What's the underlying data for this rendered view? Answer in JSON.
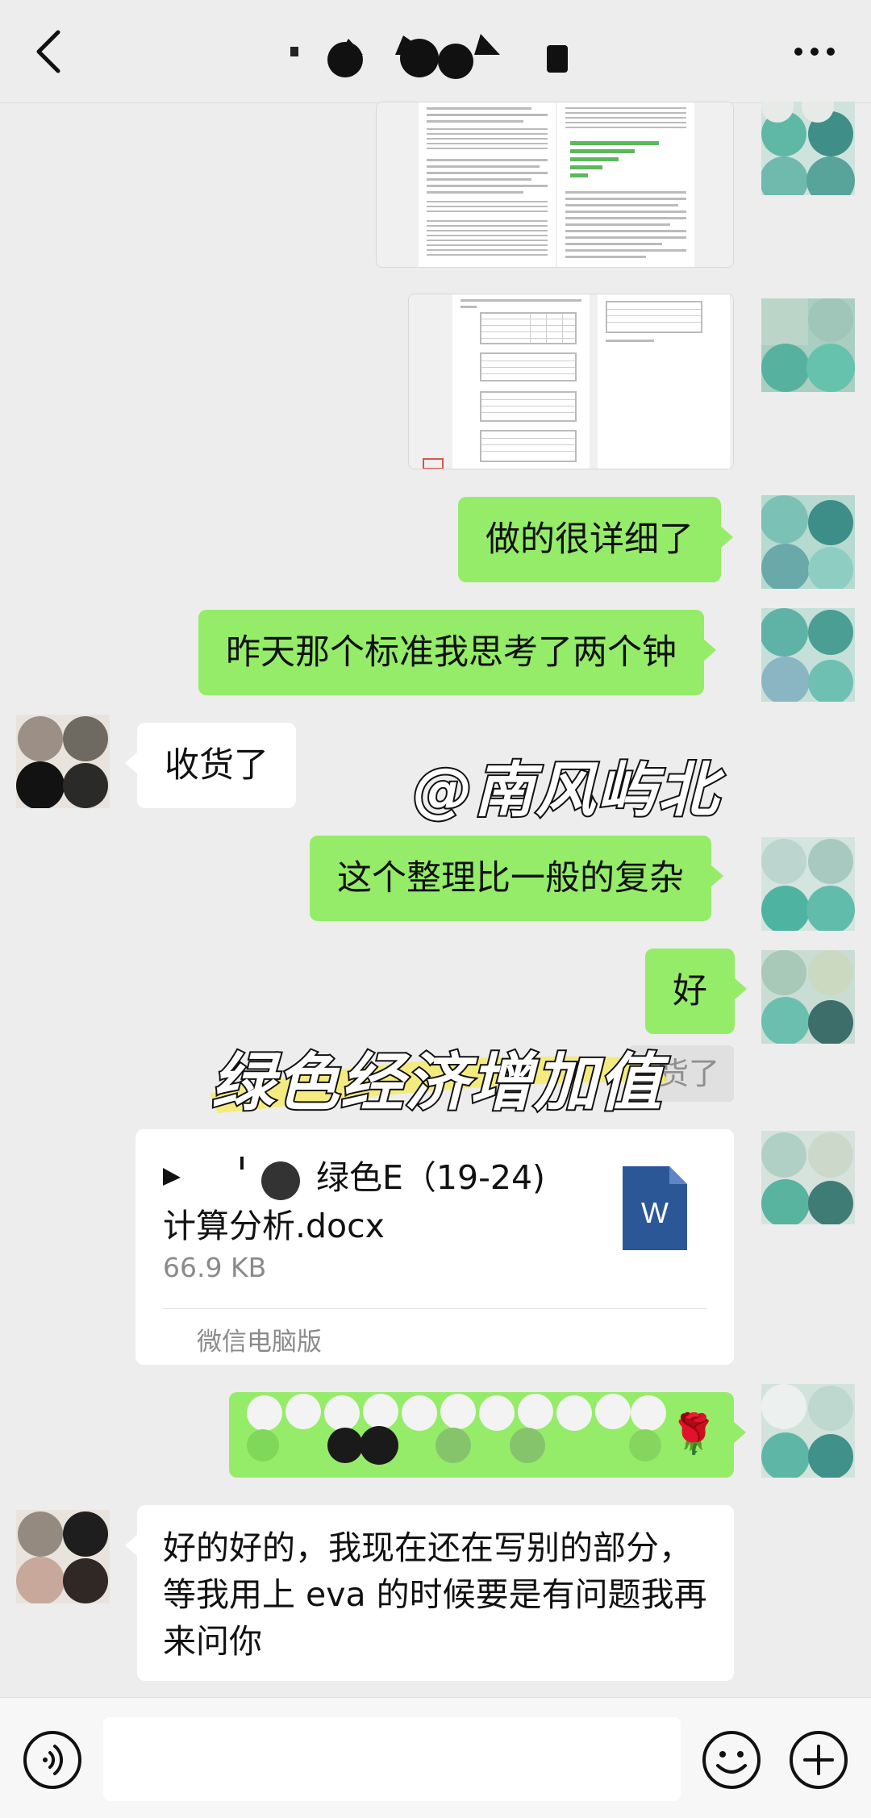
{
  "header": {
    "back_icon": "chevron-left-icon",
    "more_icon": "more-dots-icon"
  },
  "messages": {
    "m1": "做的很详细了",
    "m2": "昨天那个标准我思考了两个钟",
    "m3": "收货了",
    "m4": "这个整理比一般的复杂",
    "m5": "好",
    "m6_partial": "货了",
    "m8_emoji": "🌹",
    "m9": "好的好的，我现在还在写别的部分，等我用上 eva 的时候要是有问题我再来问你"
  },
  "file": {
    "name_line1": "绿色E（19-24)",
    "name_line2": "计算分析.docx",
    "size": "66.9 KB",
    "source": "微信电脑版",
    "icon_letter": "W"
  },
  "watermarks": {
    "handle": "@南风屿北",
    "caption": "绿色经济增加值"
  },
  "input": {
    "voice_icon": "voice-icon",
    "emoji_icon": "emoji-icon",
    "plus_icon": "plus-icon"
  },
  "colors": {
    "me_bubble": "#95ec69",
    "other_bubble": "#ffffff",
    "background": "#ededed",
    "word_blue": "#2b5797"
  }
}
